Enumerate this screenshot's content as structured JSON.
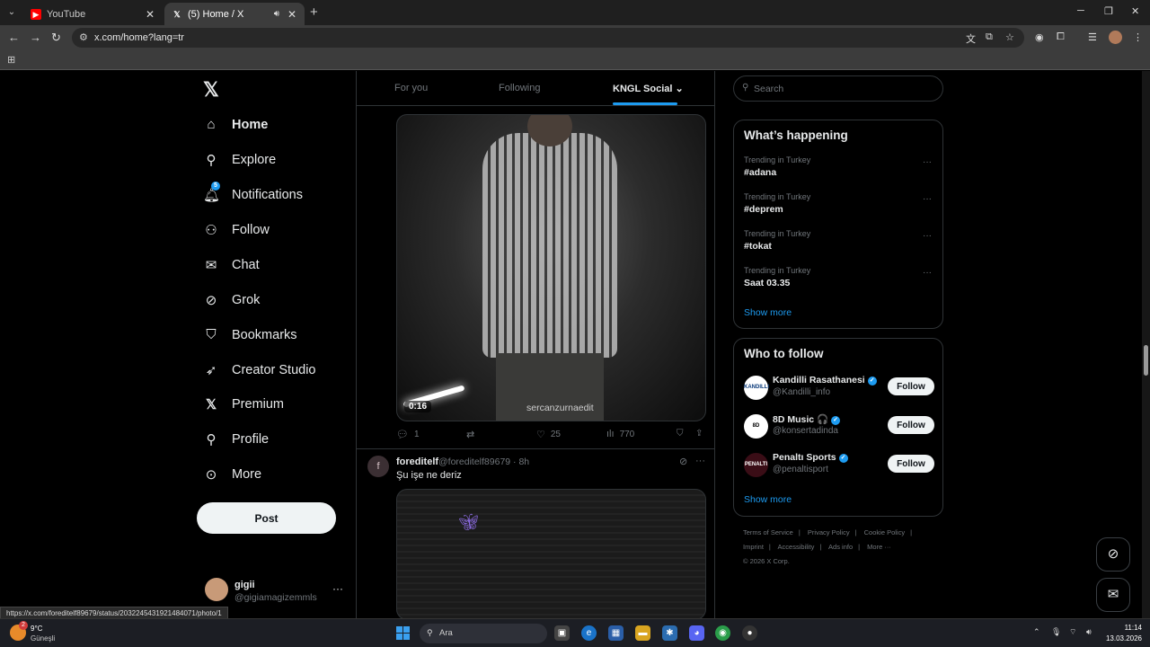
{
  "browser": {
    "tabs": [
      {
        "title": "YouTube",
        "icon": "youtube-icon"
      },
      {
        "title": "(5) Home / X",
        "icon": "x-icon"
      }
    ],
    "url": "x.com/home?lang=tr",
    "status_url": "https://x.com/foreditelf89679/status/2032245431921484071/photo/1"
  },
  "nav": {
    "items": [
      {
        "label": "Home",
        "icon": "home-icon"
      },
      {
        "label": "Explore",
        "icon": "search-icon"
      },
      {
        "label": "Notifications",
        "icon": "bell-icon",
        "badge": "5"
      },
      {
        "label": "Follow",
        "icon": "person-add-icon"
      },
      {
        "label": "Chat",
        "icon": "mail-icon"
      },
      {
        "label": "Grok",
        "icon": "grok-icon"
      },
      {
        "label": "Bookmarks",
        "icon": "bookmark-icon"
      },
      {
        "label": "Creator Studio",
        "icon": "rocket-icon"
      },
      {
        "label": "Premium",
        "icon": "x-icon"
      },
      {
        "label": "Profile",
        "icon": "person-icon"
      },
      {
        "label": "More",
        "icon": "more-circle-icon"
      }
    ],
    "post_label": "Post",
    "account": {
      "name": "gigii",
      "handle": "@gigiamagizemmls"
    }
  },
  "timeline": {
    "tabs": [
      "For you",
      "Following",
      "KNGL Social"
    ],
    "selected_tab": "KNGL Social",
    "video": {
      "duration": "0:16",
      "watermark": "sercanzurnaedit"
    },
    "actions": {
      "replies": "1",
      "reposts": "",
      "likes": "25",
      "views": "770"
    },
    "tweet2": {
      "avatar_letter": "f",
      "name": "foreditelf",
      "meta": "@foreditelf89679 · 8h",
      "text": "Şu işe ne deriz"
    }
  },
  "sidebar_right": {
    "search_placeholder": "Search",
    "whats_happening": {
      "title": "What’s happening",
      "trends": [
        {
          "context": "Trending in Turkey",
          "tag": "#adana"
        },
        {
          "context": "Trending in Turkey",
          "tag": "#deprem"
        },
        {
          "context": "Trending in Turkey",
          "tag": "#tokat"
        },
        {
          "context": "Trending in Turkey",
          "tag": "Saat 03.35"
        }
      ],
      "show_more": "Show more"
    },
    "who_to_follow": {
      "title": "Who to follow",
      "accounts": [
        {
          "name": "Kandilli Rasathanesi",
          "handle": "@Kandilli_info",
          "avatar_text": "KANDILLI"
        },
        {
          "name": "8D Music 🎧",
          "handle": "@konsertadinda",
          "avatar_text": "8D"
        },
        {
          "name": "Penaltı Sports",
          "handle": "@penaltisport",
          "avatar_text": "PENALTI"
        }
      ],
      "follow_label": "Follow",
      "show_more": "Show more"
    },
    "footer": {
      "links": [
        "Terms of Service",
        "|",
        "Privacy Policy",
        "|",
        "Cookie Policy",
        "|",
        "Imprint",
        "|",
        "Accessibility",
        "|",
        "Ads info",
        "|",
        "More ···"
      ],
      "copyright": "© 2026 X Corp."
    }
  },
  "taskbar": {
    "weather_temp": "9°C",
    "weather_desc": "Güneşli",
    "weather_badge": "2",
    "search_placeholder": "Ara",
    "time": "11:14",
    "date": "13.03.2026"
  },
  "colors": {
    "accent": "#1d9bf0",
    "background": "#000000",
    "text": "#e7e9ea",
    "muted": "#71767b"
  }
}
